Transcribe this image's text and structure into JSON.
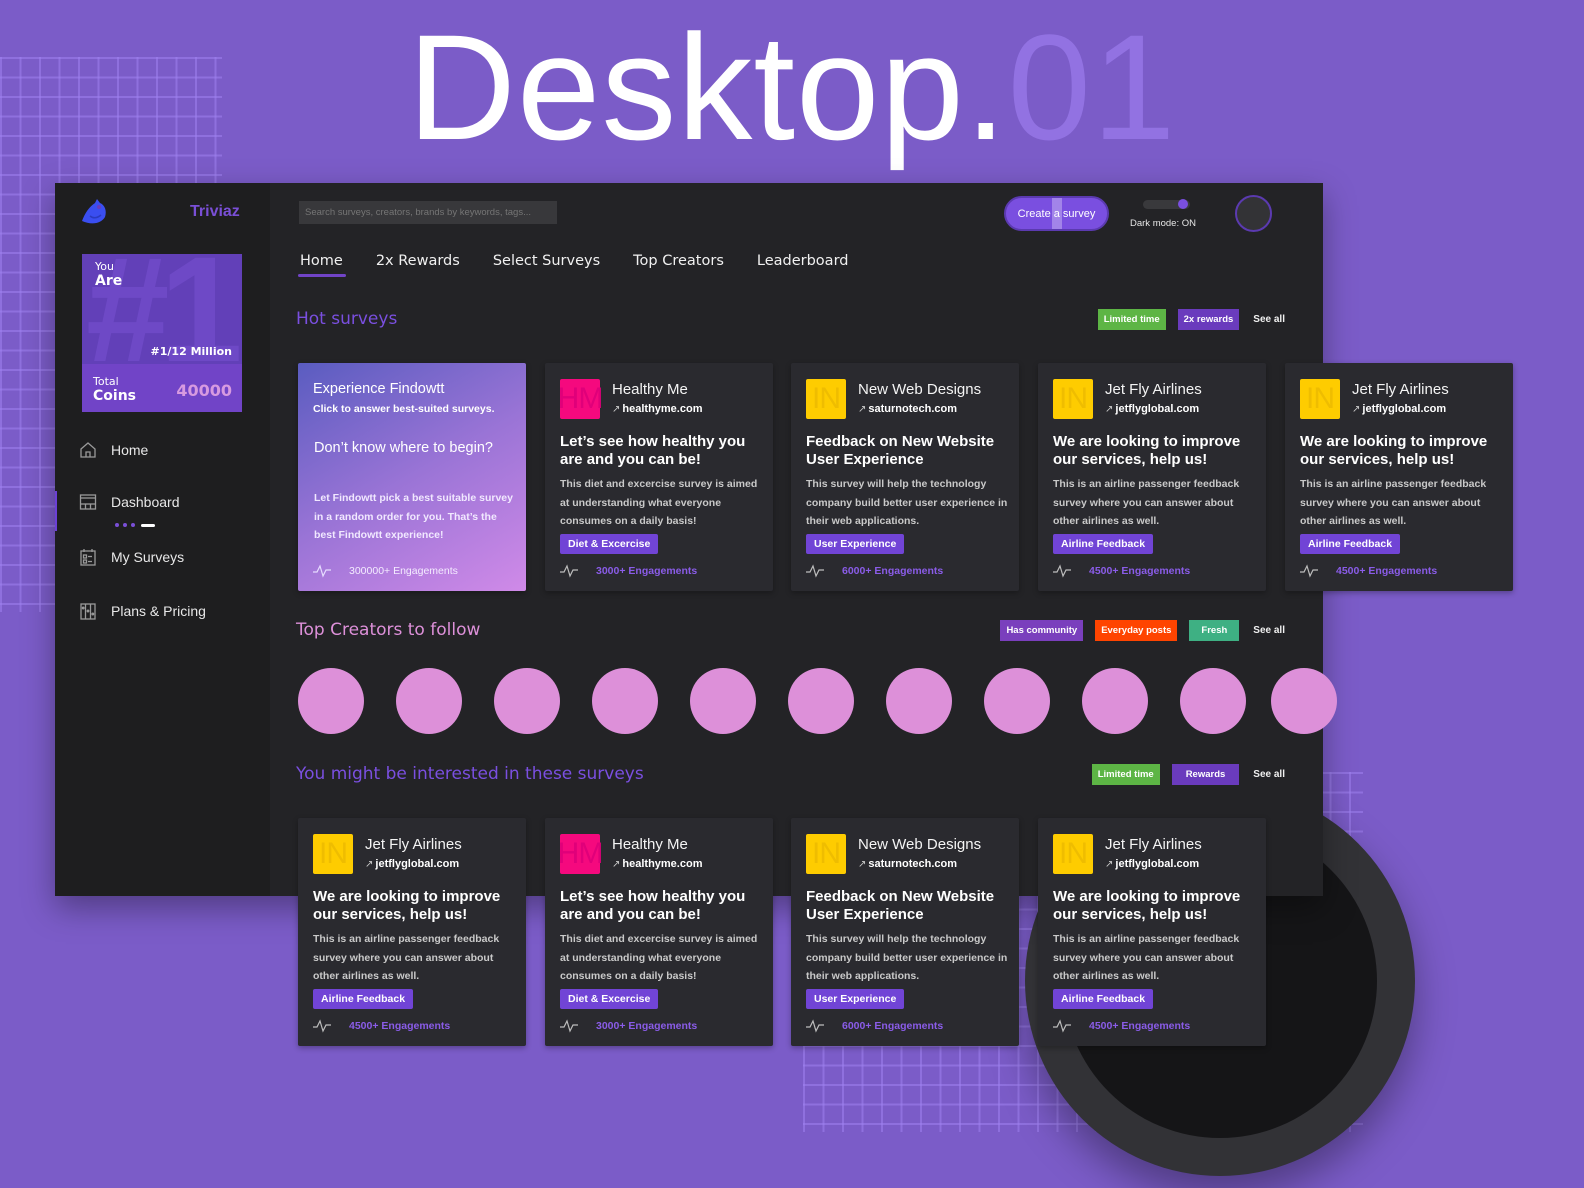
{
  "hero": {
    "title_main": "Desktop.",
    "title_accent": "01"
  },
  "colors": {
    "background": "#7b5cc8",
    "accent": "#7144c7",
    "chip_green": "#5db545",
    "chip_purple": "#6a3bbd",
    "chip_orange": "#ff4400",
    "chip_teal": "#3eb083",
    "creator_avatar": "#dd90d9",
    "logo_pink": "#f5097e",
    "logo_yellow": "#fecc00"
  },
  "sidebar": {
    "brand": "Triviaz",
    "rank_card": {
      "you": "You",
      "are": "Are",
      "rank_big": "#1",
      "rank_label": "#1/12 Million",
      "total": "Total",
      "coins": "Coins",
      "coins_value": "40000"
    },
    "items": [
      {
        "label": "Home",
        "icon": "home-icon"
      },
      {
        "label": "Dashboard",
        "icon": "dashboard-icon",
        "active": true
      },
      {
        "label": "My Surveys",
        "icon": "calendar-checklist-icon"
      },
      {
        "label": "Plans & Pricing",
        "icon": "pricing-icon"
      }
    ]
  },
  "header": {
    "search_placeholder": "Search surveys, creators, brands by keywords, tags...",
    "create_button": "Create a survey",
    "dark_mode_label": "Dark mode: ON",
    "dark_mode_on": true
  },
  "tabs": [
    {
      "label": "Home",
      "active": true
    },
    {
      "label": "2x Rewards"
    },
    {
      "label": "Select Surveys"
    },
    {
      "label": "Top Creators"
    },
    {
      "label": "Leaderboard"
    }
  ],
  "hot_surveys": {
    "title": "Hot surveys",
    "chips": [
      "Limited time",
      "2x rewards"
    ],
    "see_all": "See all",
    "promo": {
      "title": "Experience Findowtt",
      "subtitle": "Click to answer best-suited surveys.",
      "headline": "Don’t know where to begin?",
      "body": "Let Findowtt pick a best suitable survey in a random order for you. That’s the best Findowtt experience!",
      "engagements": "300000+ Engagements"
    },
    "cards": [
      {
        "initials": "HM",
        "org": "Healthy Me",
        "domain": "healthyme.com",
        "headline": "Let’s see how healthy you are and you can be!",
        "desc": "This diet and excercise survey is aimed at understanding what everyone consumes on a daily basis!",
        "tag": "Diet & Excercise",
        "engagements": "3000+ Engagements",
        "logo_color": "pink"
      },
      {
        "initials": "IN",
        "org": "New Web Designs",
        "domain": "saturnotech.com",
        "headline": "Feedback on New Website User Experience",
        "desc": "This survey will help the technology company build better user experience in their web applications.",
        "tag": "User Experience",
        "engagements": "6000+ Engagements",
        "logo_color": "yellow"
      },
      {
        "initials": "IN",
        "org": "Jet Fly Airlines",
        "domain": "jetflyglobal.com",
        "headline": "We are looking to improve our services, help us!",
        "desc": "This is an airline passenger feedback survey where you can answer about other airlines as well.",
        "tag": "Airline Feedback",
        "engagements": "4500+ Engagements",
        "logo_color": "yellow"
      },
      {
        "initials": "IN",
        "org": "Jet Fly Airlines",
        "domain": "jetflyglobal.com",
        "headline": "We are looking to improve our services, help us!",
        "desc": "This is an airline passenger feedback survey where you can answer about other airlines as well.",
        "tag": "Airline Feedback",
        "engagements": "4500+ Engagements",
        "logo_color": "yellow"
      }
    ]
  },
  "top_creators": {
    "title": "Top Creators to follow",
    "chips": [
      "Has community",
      "Everyday posts",
      "Fresh"
    ],
    "see_all": "See all",
    "count": 11
  },
  "interested": {
    "title": "You might be interested in these surveys",
    "chips": [
      "Limited time",
      "Rewards"
    ],
    "see_all": "See all",
    "cards": [
      {
        "initials": "IN",
        "org": "Jet Fly Airlines",
        "domain": "jetflyglobal.com",
        "headline": "We are looking to improve our services, help us!",
        "desc": "This is an airline passenger feedback survey where you can answer about other airlines as well.",
        "tag": "Airline Feedback",
        "engagements": "4500+ Engagements",
        "logo_color": "yellow"
      },
      {
        "initials": "HM",
        "org": "Healthy Me",
        "domain": "healthyme.com",
        "headline": "Let’s see how healthy you are and you can be!",
        "desc": "This diet and excercise survey is aimed at understanding what everyone consumes on a daily basis!",
        "tag": "Diet & Excercise",
        "engagements": "3000+ Engagements",
        "logo_color": "pink"
      },
      {
        "initials": "IN",
        "org": "New Web Designs",
        "domain": "saturnotech.com",
        "headline": "Feedback on New Website User Experience",
        "desc": "This survey will help the technology company build better user experience in their web applications.",
        "tag": "User Experience",
        "engagements": "6000+ Engagements",
        "logo_color": "yellow"
      },
      {
        "initials": "IN",
        "org": "Jet Fly Airlines",
        "domain": "jetflyglobal.com",
        "headline": "We are looking to improve our services, help us!",
        "desc": "This is an airline passenger feedback survey where you can answer about other airlines as well.",
        "tag": "Airline Feedback",
        "engagements": "4500+ Engagements",
        "logo_color": "yellow"
      }
    ]
  }
}
